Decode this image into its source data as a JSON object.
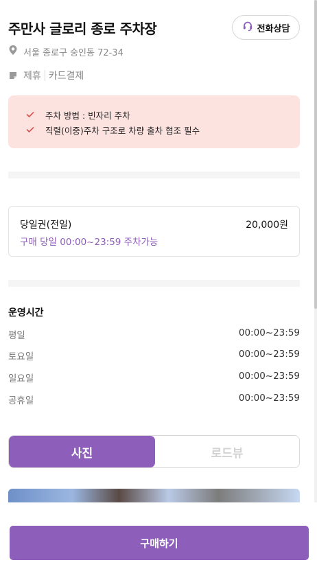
{
  "header": {
    "title": "주만사 글로리 종로 주차장",
    "call_button_label": "전화상담"
  },
  "info": {
    "address": "서울 종로구 숭인동 72-34",
    "tags": [
      "제휴",
      "카드결제"
    ]
  },
  "notices": [
    "주차 방법 : 빈자리 주차",
    "직렬(이중)주차 구조로 차량 출차 협조 필수"
  ],
  "ticket": {
    "name": "당일권(전일)",
    "price": "20,000원",
    "description": "구매 당일 00:00~23:59 주차가능"
  },
  "hours": {
    "title": "운영시간",
    "rows": [
      {
        "day": "평일",
        "time": "00:00~23:59"
      },
      {
        "day": "토요일",
        "time": "00:00~23:59"
      },
      {
        "day": "일요일",
        "time": "00:00~23:59"
      },
      {
        "day": "공휴일",
        "time": "00:00~23:59"
      }
    ]
  },
  "view_tabs": {
    "photo_label": "사진",
    "roadview_label": "로드뷰",
    "selected": "사진"
  },
  "cta": {
    "buy_label": "구매하기"
  },
  "colors": {
    "accent": "#8d5fba",
    "notice_bg": "#fde3e0",
    "check": "#d9534f",
    "muted_text": "#8a8a8a"
  },
  "icons": {
    "call": "headset-icon",
    "address": "location-pin-icon",
    "tags": "parking-tag-icon",
    "notice": "check-icon"
  }
}
